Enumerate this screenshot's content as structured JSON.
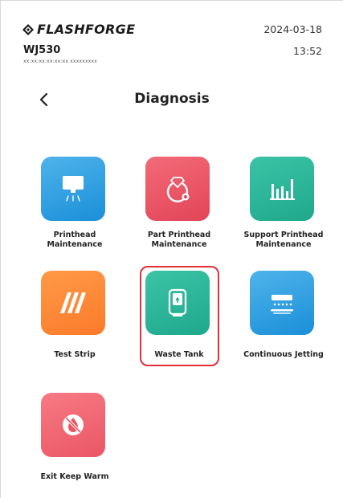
{
  "brand": {
    "name": "FLASHFORGE"
  },
  "device": {
    "model": "WJ530",
    "serial": "xx:xx:xx:xx:xx:xx  xxxxxxxxx"
  },
  "clock": {
    "date": "2024-03-18",
    "time": "13:52"
  },
  "page": {
    "title": "Diagnosis"
  },
  "colors": {
    "blue": "#1a8fd9",
    "red": "#e34557",
    "teal": "#1ea88c",
    "orange": "#fb7a2a",
    "pink": "#ea5664",
    "selection": "#e0303a"
  },
  "tiles": [
    {
      "label": "Printhead\nMaintenance",
      "icon": "printhead-icon",
      "selected": false
    },
    {
      "label": "Part Printhead\nMaintenance",
      "icon": "part-printhead-icon",
      "selected": false
    },
    {
      "label": "Support Printhead\nMaintenance",
      "icon": "support-printhead-icon",
      "selected": false
    },
    {
      "label": "Test Strip",
      "icon": "test-strip-icon",
      "selected": false
    },
    {
      "label": "Waste Tank",
      "icon": "waste-tank-icon",
      "selected": true
    },
    {
      "label": "Continuous Jetting",
      "icon": "continuous-jetting-icon",
      "selected": false
    },
    {
      "label": "Exit Keep Warm",
      "icon": "exit-keep-warm-icon",
      "selected": false
    }
  ]
}
